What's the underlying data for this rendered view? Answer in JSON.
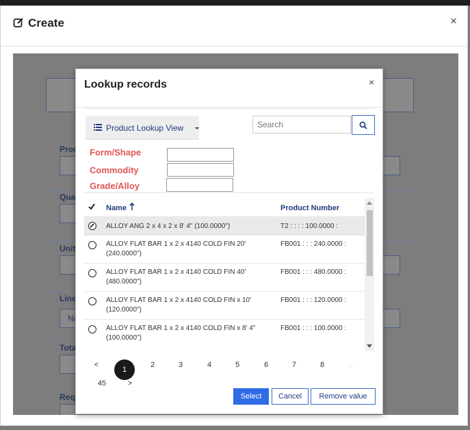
{
  "outer": {
    "title": "Create",
    "close": "×"
  },
  "modal": {
    "title": "Lookup records",
    "close": "×"
  },
  "view_selector": {
    "label": "Product Lookup View"
  },
  "search": {
    "placeholder": "Search"
  },
  "filters": [
    {
      "label": "Form/Shape",
      "value": ""
    },
    {
      "label": "Commodity",
      "value": ""
    },
    {
      "label": "Grade/Alloy",
      "value": ""
    }
  ],
  "grid": {
    "columns": {
      "name": "Name",
      "product_number": "Product Number"
    },
    "rows": [
      {
        "name": "ALLOY ANG 2 x 4 x 2 x 8' 4\" (100.0000\")",
        "product_number": "T2 : : : : 100.0000 :",
        "selected": true
      },
      {
        "name": "ALLOY FLAT BAR 1 x 2 x 4140 COLD FIN 20' (240.0000\")",
        "product_number": "FB001 : : : 240.0000 :",
        "selected": false
      },
      {
        "name": "ALLOY FLAT BAR 1 x 2 x 4140 COLD FIN 40' (480.0000\")",
        "product_number": "FB001 : : : 480.0000 :",
        "selected": false
      },
      {
        "name": "ALLOY FLAT BAR 1 x 2 x 4140 COLD FIN x 10' (120.0000\")",
        "product_number": "FB001 : : : 120.0000 :",
        "selected": false
      },
      {
        "name": "ALLOY FLAT BAR 1 x 2 x 4140 COLD FIN x 8' 4\" (100.0000\")",
        "product_number": "FB001 : : : 100.0000 :",
        "selected": false
      }
    ]
  },
  "pagination": {
    "prev": "<",
    "pages": [
      "1",
      "2",
      "3",
      "4",
      "5",
      "6",
      "7",
      "8"
    ],
    "ellipsis": "..",
    "last": "45",
    "next": ">",
    "current": "1"
  },
  "actions": {
    "select": "Select",
    "cancel": "Cancel",
    "remove": "Remove value"
  },
  "background_form": {
    "labels": [
      "Prod",
      "Qua",
      "Unit",
      "Line",
      "Tota",
      "Requ"
    ],
    "line_value": "No"
  },
  "colors": {
    "accent": "#2f6be4",
    "filter_label": "#e05656",
    "link": "#1e3b80"
  }
}
